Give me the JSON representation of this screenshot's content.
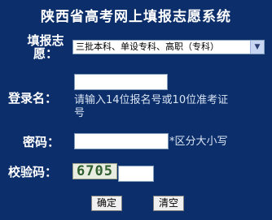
{
  "page": {
    "title": "陕西省高考网上填报志愿系统"
  },
  "form": {
    "batch_label_line1": "填报志",
    "batch_label_line2": "愿：",
    "batch_selected": "三批本科、单设专科、高职（专科）",
    "login_label": "登录名：",
    "login_hint_line1": "请输入14位报名号或10位准考证",
    "login_hint_line2": "号",
    "password_label": "密码：",
    "password_hint": "*区分大小写",
    "captcha_label": "校验码：",
    "captcha_code": "6705",
    "confirm_label": "确定",
    "clear_label": "清空"
  },
  "colors": {
    "background": "#0c2f6b",
    "text": "#ffffff"
  }
}
